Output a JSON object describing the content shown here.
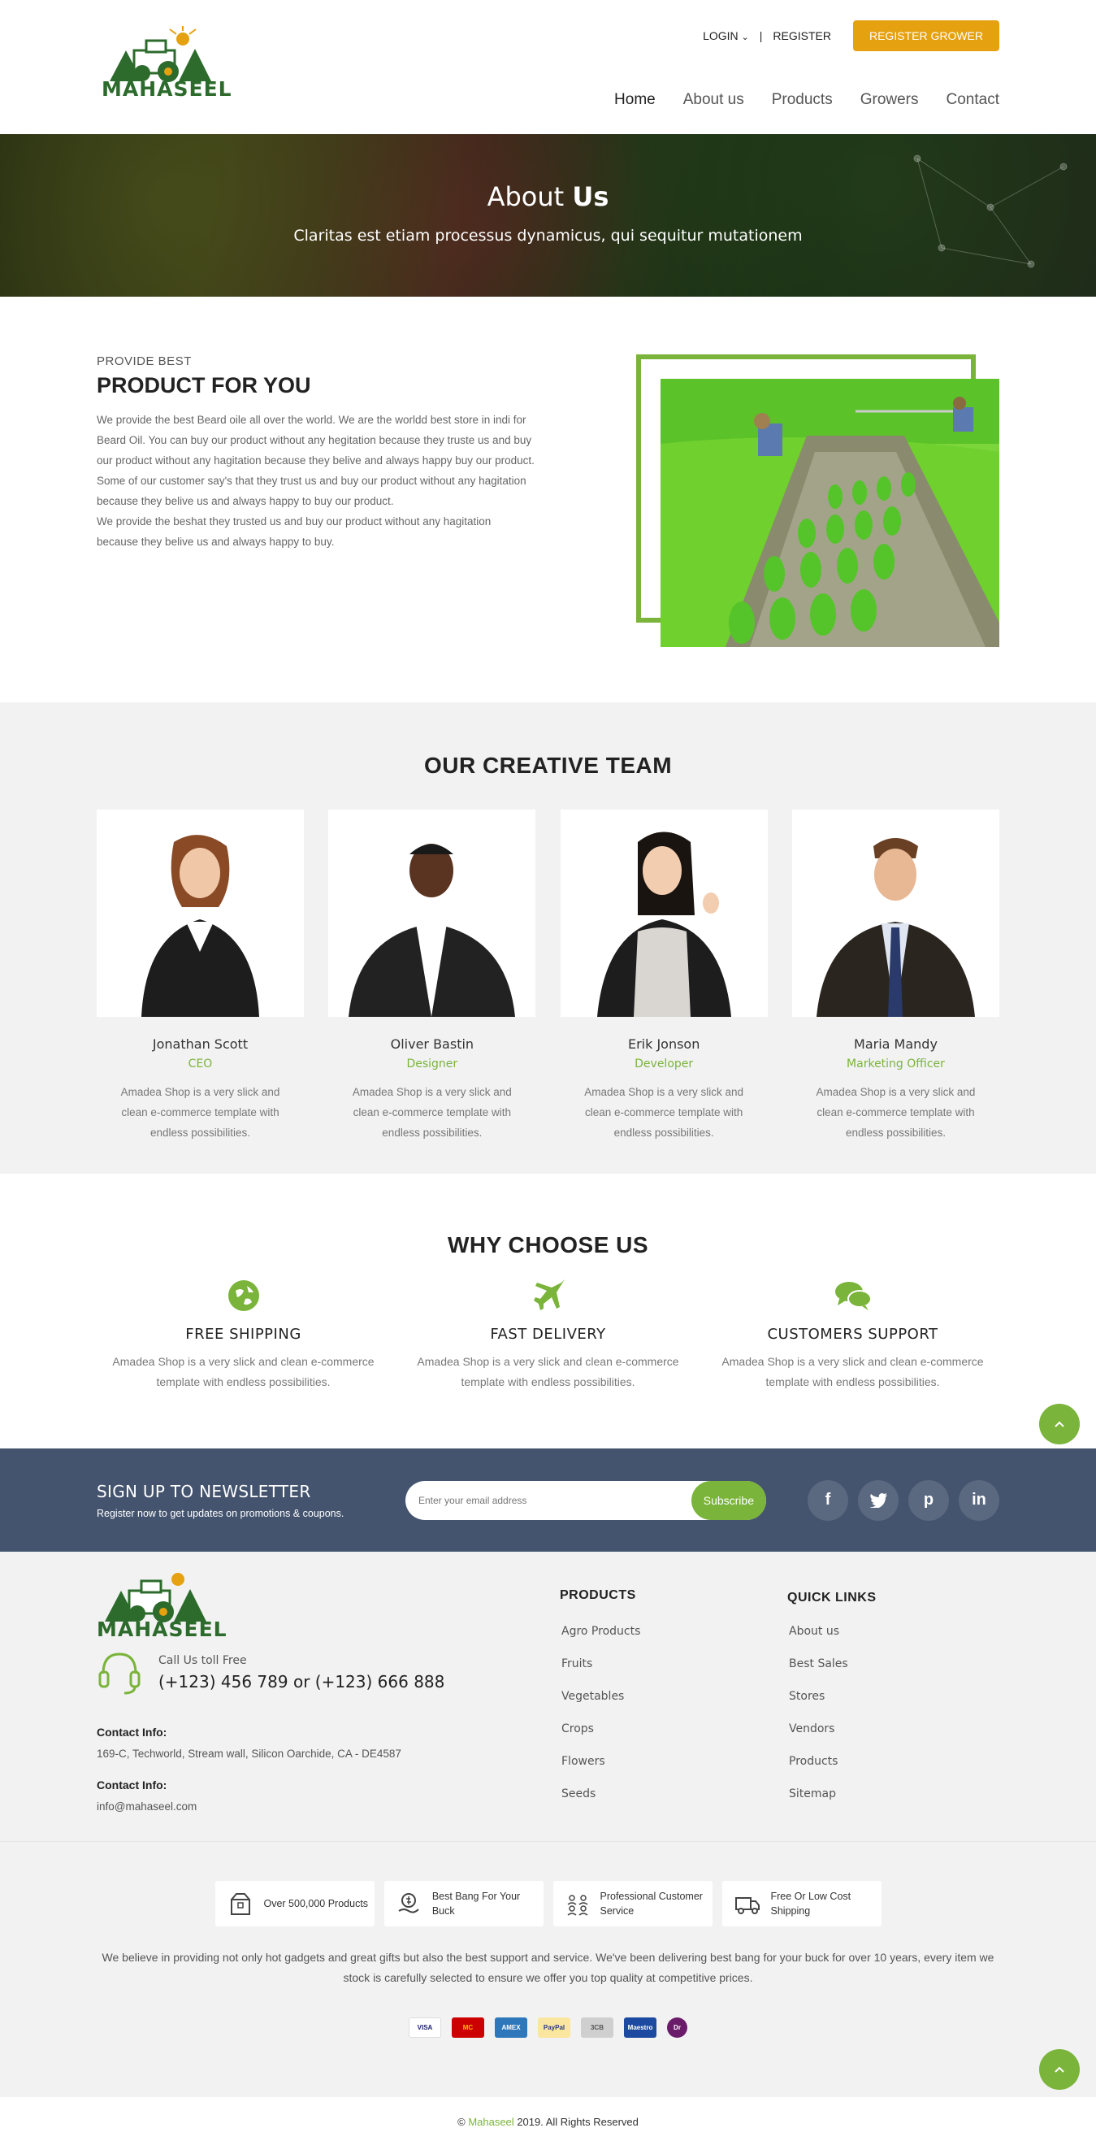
{
  "brand": {
    "logo_text": "MAHASEEL",
    "accent": "#7ab43a",
    "orange": "#e5a110"
  },
  "topbar": {
    "login": "LOGIN",
    "register": "REGISTER",
    "register_grower": "REGISTER GROWER"
  },
  "nav": [
    {
      "label": "Home"
    },
    {
      "label": "About us"
    },
    {
      "label": "Products"
    },
    {
      "label": "Growers"
    },
    {
      "label": "Contact"
    }
  ],
  "hero": {
    "title_light": "About",
    "title_bold": "Us",
    "subtitle": "Claritas est etiam processus dynamicus, qui sequitur mutationem"
  },
  "about": {
    "eyebrow": "PROVIDE BEST",
    "title": "PRODUCT FOR YOU",
    "paragraphs": [
      "We provide the best Beard oile all over the world. We are the worldd best store in indi for Beard Oil. You can buy our product without any hegitation because they truste us and buy our product without any hagitation because they belive and always happy buy our product.",
      "Some of our customer say's that they trust us and buy our product without any hagitation because they belive us and always happy to buy our product.",
      "We provide the beshat they trusted us and buy our product without any hagitation because they belive us and always happy to buy."
    ]
  },
  "team": {
    "title": "OUR CREATIVE TEAM",
    "members": [
      {
        "name": "Jonathan Scott",
        "role": "CEO",
        "desc": "Amadea Shop is a very slick and clean e-commerce template with endless possibilities."
      },
      {
        "name": "Oliver Bastin",
        "role": "Designer",
        "desc": "Amadea Shop is a very slick and clean e-commerce template with endless possibilities."
      },
      {
        "name": "Erik Jonson",
        "role": "Developer",
        "desc": "Amadea Shop is a very slick and clean e-commerce template with endless possibilities."
      },
      {
        "name": "Maria Mandy",
        "role": "Marketing Officer",
        "desc": "Amadea Shop is a very slick and clean e-commerce template with endless possibilities."
      }
    ]
  },
  "why": {
    "title": "WHY CHOOSE US",
    "items": [
      {
        "icon": "globe-icon",
        "title": "FREE SHIPPING",
        "desc": "Amadea Shop is a very slick and clean e-commerce template with endless possibilities."
      },
      {
        "icon": "plane-icon",
        "title": "FAST DELIVERY",
        "desc": "Amadea Shop is a very slick and clean e-commerce template with endless possibilities."
      },
      {
        "icon": "chat-icon",
        "title": "CUSTOMERS SUPPORT",
        "desc": "Amadea Shop is a very slick and clean e-commerce template with endless possibilities."
      }
    ]
  },
  "newsletter": {
    "title": "SIGN UP TO NEWSLETTER",
    "subtitle": "Register now to get updates on promotions & coupons.",
    "placeholder": "Enter your email address",
    "button": "Subscribe",
    "social": [
      {
        "icon": "facebook-icon",
        "glyph": "f"
      },
      {
        "icon": "twitter-icon",
        "glyph": "t"
      },
      {
        "icon": "pinterest-icon",
        "glyph": "p"
      },
      {
        "icon": "linkedin-icon",
        "glyph": "in"
      }
    ]
  },
  "footer": {
    "call_label": "Call Us toll Free",
    "phone": "(+123) 456 789 or (+123) 666 888",
    "contact_title_1": "Contact Info:",
    "address": "169-C, Techworld, Stream wall, Silicon Oarchide, CA - DE4587",
    "contact_title_2": "Contact Info:",
    "email": "info@mahaseel.com",
    "products_title": "PRODUCTS",
    "products": [
      "Agro Products",
      "Fruits",
      "Vegetables",
      "Crops",
      "Flowers",
      "Seeds"
    ],
    "links_title": "QUICK LINKS",
    "links": [
      "About us",
      "Best Sales",
      "Stores",
      "Vendors",
      "Products",
      "Sitemap"
    ]
  },
  "badges": [
    {
      "icon": "box-icon",
      "text": "Over 500,000 Products"
    },
    {
      "icon": "money-hand-icon",
      "text": "Best Bang For Your Buck"
    },
    {
      "icon": "people-icon",
      "text": "Professional Customer Service"
    },
    {
      "icon": "truck-icon",
      "text": "Free Or Low Cost Shipping"
    }
  ],
  "bottom_text": "We believe in providing not only hot gadgets and great gifts but also the best support and service. We've been delivering best bang for your buck for over 10 years, every item we stock is carefully selected to ensure we offer you top quality at competitive prices.",
  "payments": [
    {
      "name": "VISA",
      "color": "#ffffff",
      "fg": "#1a1f71"
    },
    {
      "name": "MC",
      "color": "#cc0000",
      "fg": "#ffb600"
    },
    {
      "name": "AMEX",
      "color": "#2e77bb",
      "fg": "#ffffff"
    },
    {
      "name": "PayPal",
      "color": "#fbe6a0",
      "fg": "#253b80"
    },
    {
      "name": "3CB",
      "color": "#cfcfcf",
      "fg": "#555555"
    },
    {
      "name": "Maestro",
      "color": "#1b4aa0",
      "fg": "#ffffff"
    },
    {
      "name": "Dr",
      "color": "#6a1c6a",
      "fg": "#ffffff"
    }
  ],
  "copyright": {
    "symbol": "©",
    "brand": "Mahaseel",
    "rest": "2019. All Rights Reserved"
  }
}
